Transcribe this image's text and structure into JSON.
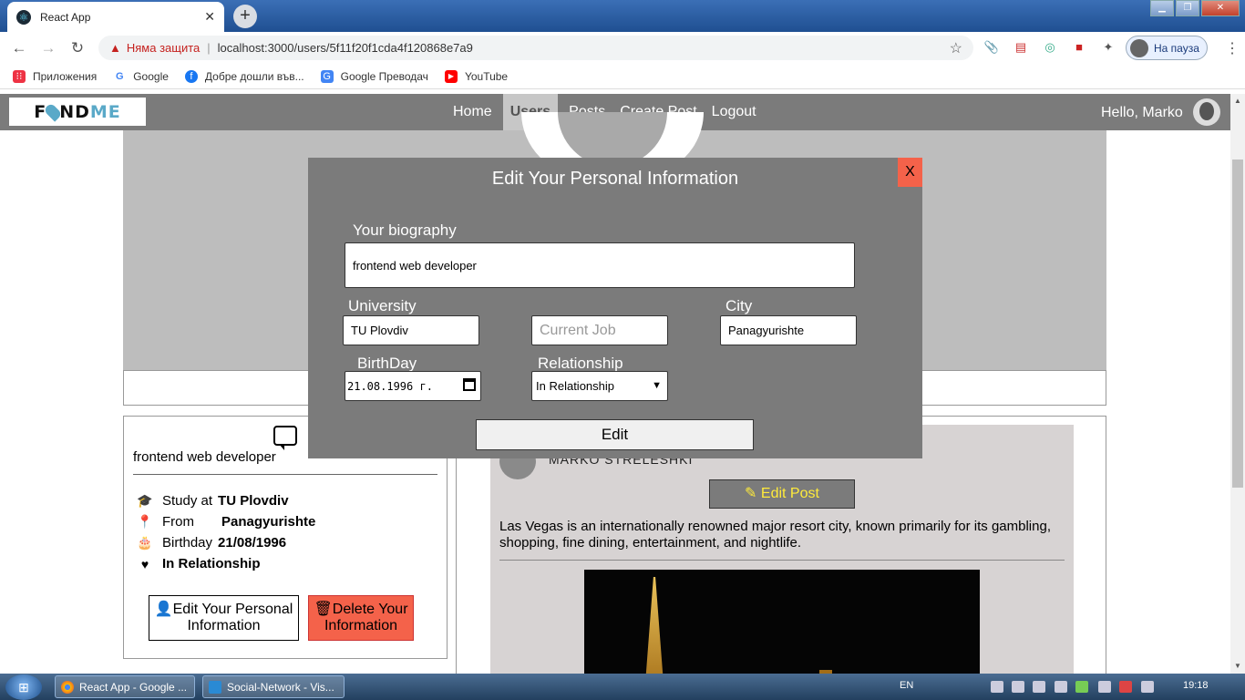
{
  "browser": {
    "tab_title": "React App",
    "tab_close": "✕",
    "new_tab": "+",
    "security_label": "Няма защита",
    "url": "localhost:3000/users/5f11f20f1cda4f120868e7a9",
    "profile_status": "На пауза",
    "bookmarks": [
      {
        "label": "Приложения",
        "icon": "apps-icon"
      },
      {
        "label": "Google",
        "icon": "google-icon"
      },
      {
        "label": "Добре дошли във...",
        "icon": "facebook-icon"
      },
      {
        "label": "Google Преводач",
        "icon": "translate-icon"
      },
      {
        "label": "YouTube",
        "icon": "youtube-icon"
      }
    ]
  },
  "navbar": {
    "logo_left": "F",
    "logo_mid": "ND",
    "logo_right": "ME",
    "links": [
      "Home",
      "Users",
      "Posts",
      "Create Post",
      "Logout"
    ],
    "active_link": "Users",
    "greeting": "Hello, Marko"
  },
  "profile": {
    "bio": "frontend web developer",
    "study_label": "Study at",
    "study_value": "TU Plovdiv",
    "from_label": "From",
    "from_value": "Panagyurishte",
    "birthday_label": "Birthday",
    "birthday_value": "21/08/1996",
    "relationship_value": "In Relationship",
    "edit_button": "Edit Your Personal Information",
    "delete_button": "Delete Your Information"
  },
  "post": {
    "author": "MARKO STRELESHKI",
    "edit_button": "Edit Post",
    "text": "Las Vegas is an internationally renowned major resort city, known primarily for its gambling, shopping, fine dining, entertainment, and nightlife."
  },
  "modal": {
    "title": "Edit Your Personal Information",
    "close": "X",
    "biography_label": "Your biography",
    "biography_value": "frontend web developer",
    "university_label": "University",
    "university_value": "TU Plovdiv",
    "job_placeholder": "Current Job",
    "city_label": "City",
    "city_value": "Panagyurishte",
    "birthday_label": "BirthDay",
    "birthday_value": "21.08.1996 г.",
    "relationship_label": "Relationship",
    "relationship_value": "In Relationship",
    "submit": "Edit"
  },
  "taskbar": {
    "tasks": [
      "React App - Google ...",
      "Social-Network - Vis..."
    ],
    "lang": "EN",
    "time": "19:18"
  },
  "colors": {
    "navbar_bg": "#7b7b7b",
    "danger": "#f4624a",
    "accent_yellow": "#ffeb3b",
    "logo_accent": "#5aa9c8"
  }
}
